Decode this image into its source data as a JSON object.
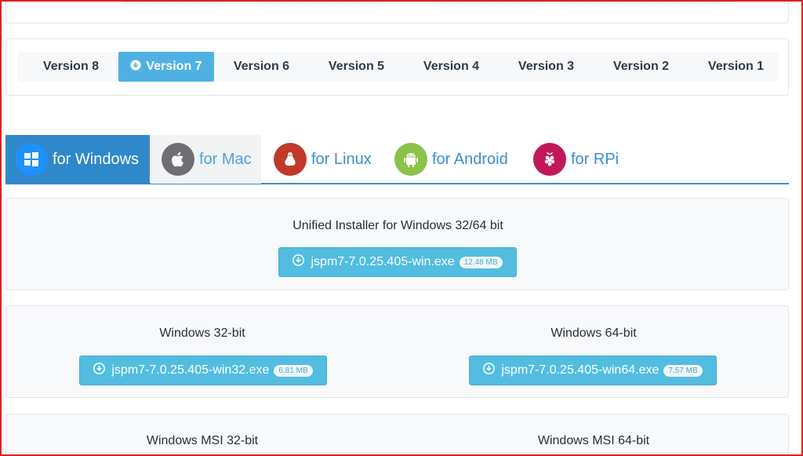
{
  "versions": {
    "tabs": [
      {
        "label": "Version 8"
      },
      {
        "label": "Version 7",
        "active": true
      },
      {
        "label": "Version 6"
      },
      {
        "label": "Version 5"
      },
      {
        "label": "Version 4"
      },
      {
        "label": "Version 3"
      },
      {
        "label": "Version 2"
      },
      {
        "label": "Version 1"
      }
    ]
  },
  "os_tabs": [
    {
      "label": "for Windows",
      "icon": "windows-icon",
      "color": "#1e90ff",
      "active": true
    },
    {
      "label": "for Mac",
      "icon": "apple-icon",
      "color": "#6d6f72"
    },
    {
      "label": "for Linux",
      "icon": "linux-icon",
      "color": "#c0392b"
    },
    {
      "label": "for Android",
      "icon": "android-icon",
      "color": "#8bc34a"
    },
    {
      "label": "for RPi",
      "icon": "raspberry-pi-icon",
      "color": "#c2185b"
    }
  ],
  "unified": {
    "title": "Unified Installer for Windows 32/64 bit",
    "file": "jspm7-7.0.25.405-win.exe",
    "size": "12.48 MB"
  },
  "win32": {
    "title": "Windows 32-bit",
    "file": "jspm7-7.0.25.405-win32.exe",
    "size": "6.81 MB"
  },
  "win64": {
    "title": "Windows 64-bit",
    "file": "jspm7-7.0.25.405-win64.exe",
    "size": "7.57 MB"
  },
  "msi32": {
    "title": "Windows MSI 32-bit"
  },
  "msi64": {
    "title": "Windows MSI 64-bit"
  },
  "colors": {
    "accent": "#52bde0",
    "tab_active": "#2f88c9",
    "version_active": "#4fb1e3",
    "frame": "#e02020"
  }
}
